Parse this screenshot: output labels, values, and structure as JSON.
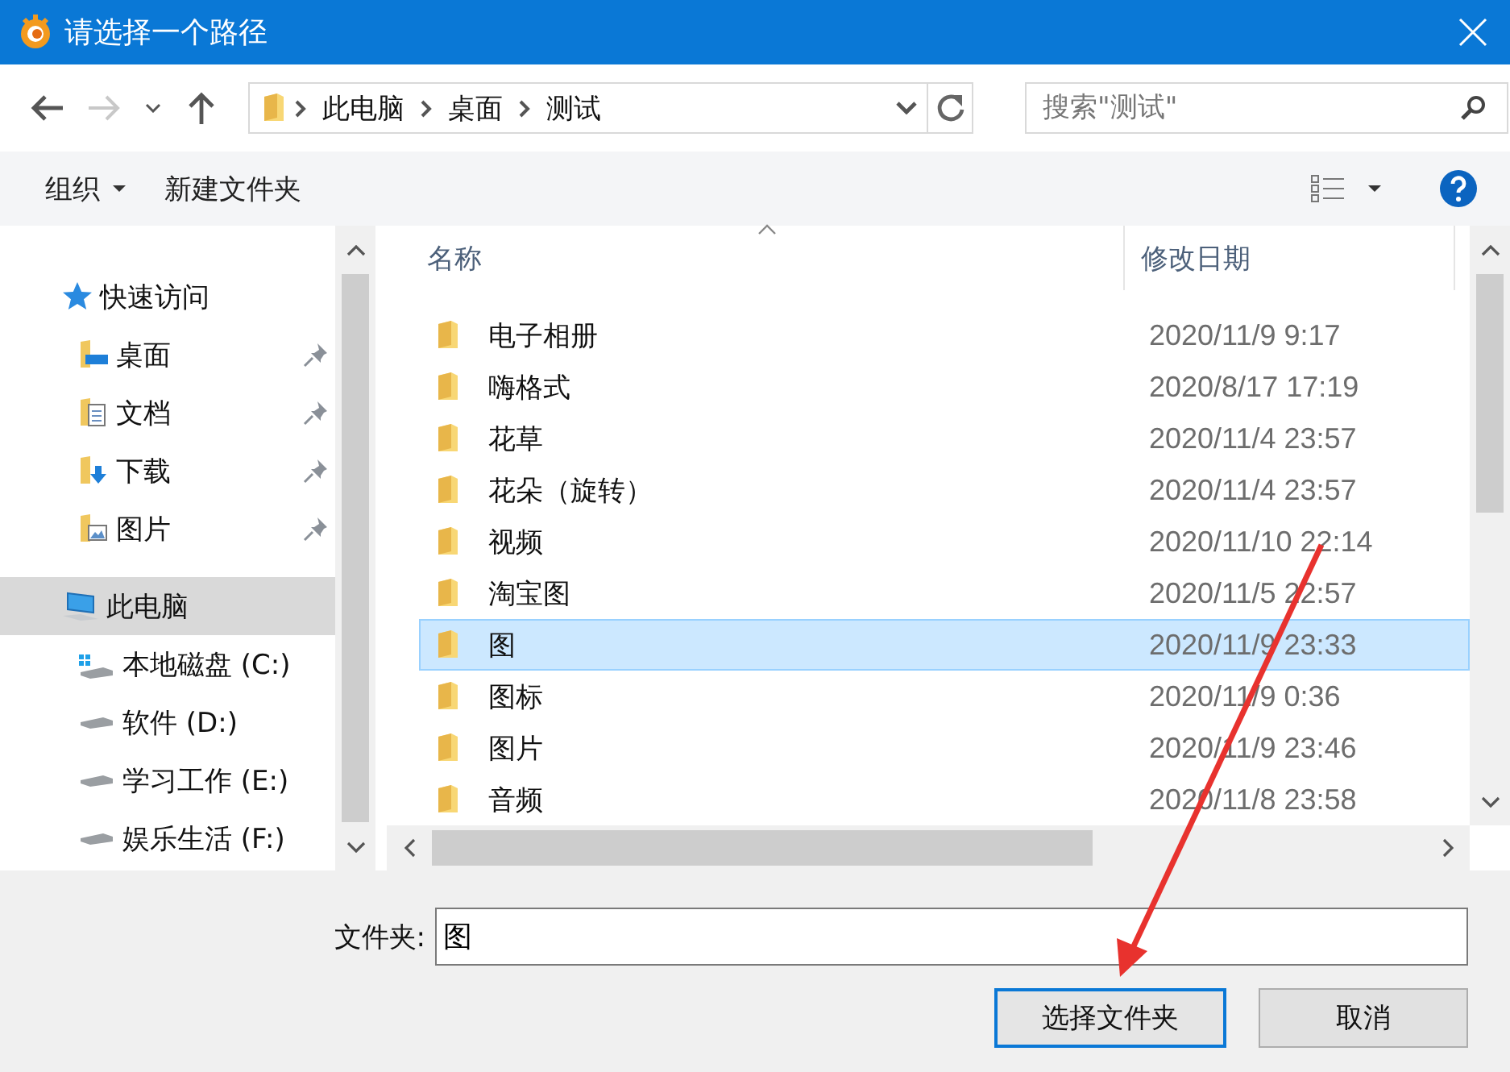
{
  "window": {
    "title": "请选择一个路径"
  },
  "address": {
    "crumbs": [
      "此电脑",
      "桌面",
      "测试"
    ]
  },
  "search": {
    "placeholder": "搜索\"测试\""
  },
  "toolbar": {
    "organize": "组织",
    "new_folder": "新建文件夹"
  },
  "sidebar": {
    "items": [
      {
        "label": "快速访问",
        "kind": "star",
        "selected": false,
        "children": [
          {
            "label": "桌面",
            "kind": "desktop",
            "pinned": true,
            "selected": false
          },
          {
            "label": "文档",
            "kind": "documents",
            "pinned": true,
            "selected": false
          },
          {
            "label": "下载",
            "kind": "downloads",
            "pinned": true,
            "selected": false
          },
          {
            "label": "图片",
            "kind": "pictures",
            "pinned": true,
            "selected": false
          }
        ]
      },
      {
        "label": "此电脑",
        "kind": "computer",
        "selected": true,
        "children": [
          {
            "label": "本地磁盘 (C:)",
            "kind": "system-drive",
            "pinned": false,
            "selected": false
          },
          {
            "label": "软件 (D:)",
            "kind": "drive",
            "pinned": false,
            "selected": false
          },
          {
            "label": "学习工作 (E:)",
            "kind": "drive",
            "pinned": false,
            "selected": false
          },
          {
            "label": "娱乐生活 (F:)",
            "kind": "drive",
            "pinned": false,
            "selected": false
          }
        ]
      }
    ]
  },
  "table": {
    "columns": [
      "名称",
      "修改日期"
    ],
    "rows": [
      {
        "name": "电子相册",
        "modified": "2020/11/9 9:17",
        "selected": false
      },
      {
        "name": "嗨格式",
        "modified": "2020/8/17 17:19",
        "selected": false
      },
      {
        "name": "花草",
        "modified": "2020/11/4 23:57",
        "selected": false
      },
      {
        "name": "花朵（旋转）",
        "modified": "2020/11/4 23:57",
        "selected": false
      },
      {
        "name": "视频",
        "modified": "2020/11/10 22:14",
        "selected": false
      },
      {
        "name": "淘宝图",
        "modified": "2020/11/5 22:57",
        "selected": false
      },
      {
        "name": "图",
        "modified": "2020/11/9 23:33",
        "selected": true
      },
      {
        "name": "图标",
        "modified": "2020/11/9 0:36",
        "selected": false
      },
      {
        "name": "图片",
        "modified": "2020/11/9 23:46",
        "selected": false
      },
      {
        "name": "音频",
        "modified": "2020/11/8 23:58",
        "selected": false
      }
    ]
  },
  "folder_field": {
    "label": "文件夹:",
    "value": "图"
  },
  "buttons": [
    {
      "label": "选择文件夹",
      "kind": "primary"
    },
    {
      "label": "取消",
      "kind": "secondary"
    }
  ]
}
